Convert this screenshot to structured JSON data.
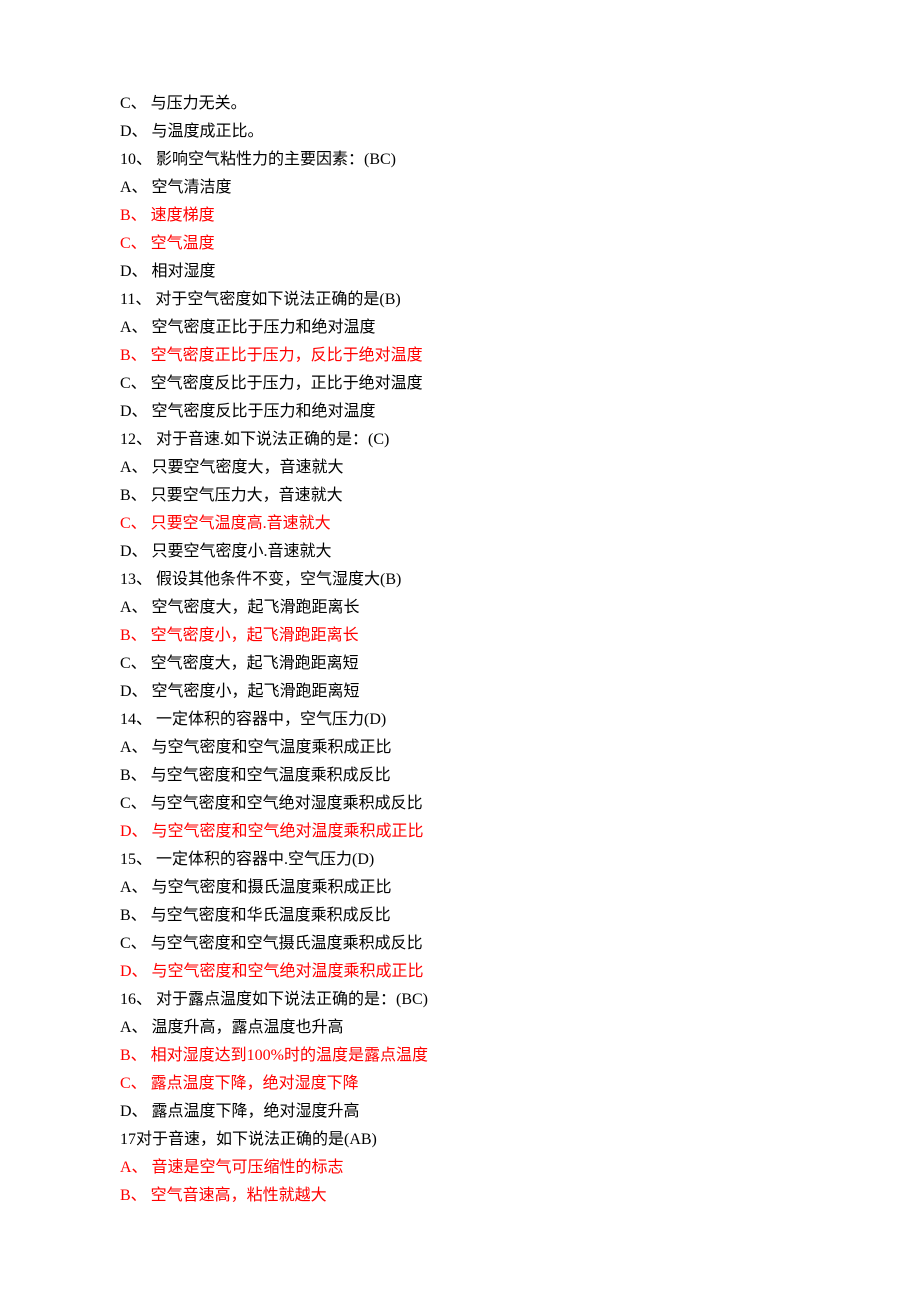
{
  "lines": [
    {
      "text": "C、 与压力无关。",
      "red": false
    },
    {
      "text": "D、 与温度成正比。",
      "red": false
    },
    {
      "text": "10、 影响空气粘性力的主要因素：(BC)",
      "red": false
    },
    {
      "text": "A、 空气清洁度",
      "red": false
    },
    {
      "text": "B、 速度梯度",
      "red": true
    },
    {
      "text": "C、 空气温度",
      "red": true
    },
    {
      "text": "D、 相对湿度",
      "red": false
    },
    {
      "text": "11、 对于空气密度如下说法正确的是(B)",
      "red": false
    },
    {
      "text": "A、 空气密度正比于压力和绝对温度",
      "red": false
    },
    {
      "text": "B、 空气密度正比于压力，反比于绝对温度",
      "red": true
    },
    {
      "text": "C、 空气密度反比于压力，正比于绝对温度",
      "red": false
    },
    {
      "text": "D、 空气密度反比于压力和绝对温度",
      "red": false
    },
    {
      "text": "12、 对于音速.如下说法正确的是：(C)",
      "red": false
    },
    {
      "text": "A、 只要空气密度大，音速就大",
      "red": false
    },
    {
      "text": "B、 只要空气压力大，音速就大",
      "red": false
    },
    {
      "text": "C、 只要空气温度高.音速就大",
      "red": true
    },
    {
      "text": "D、 只要空气密度小.音速就大",
      "red": false
    },
    {
      "text": "13、 假设其他条件不变，空气湿度大(B)",
      "red": false
    },
    {
      "text": "A、 空气密度大，起飞滑跑距离长",
      "red": false
    },
    {
      "text": "B、 空气密度小，起飞滑跑距离长",
      "red": true
    },
    {
      "text": "C、 空气密度大，起飞滑跑距离短",
      "red": false
    },
    {
      "text": "D、 空气密度小，起飞滑跑距离短",
      "red": false
    },
    {
      "text": "14、 一定体积的容器中，空气压力(D)",
      "red": false
    },
    {
      "text": "A、 与空气密度和空气温度乘积成正比",
      "red": false
    },
    {
      "text": "B、 与空气密度和空气温度乘积成反比",
      "red": false
    },
    {
      "text": "C、 与空气密度和空气绝对湿度乘积成反比",
      "red": false
    },
    {
      "text": "D、 与空气密度和空气绝对温度乘积成正比",
      "red": true
    },
    {
      "text": "15、 一定体积的容器中.空气压力(D)",
      "red": false
    },
    {
      "text": "A、 与空气密度和摄氏温度乘积成正比",
      "red": false
    },
    {
      "text": "B、 与空气密度和华氏温度乘积成反比",
      "red": false
    },
    {
      "text": "C、 与空气密度和空气摄氏温度乘积成反比",
      "red": false
    },
    {
      "text": "D、 与空气密度和空气绝对温度乘积成正比",
      "red": true
    },
    {
      "text": "16、 对于露点温度如下说法正确的是：(BC)",
      "red": false
    },
    {
      "text": "A、 温度升高，露点温度也升高",
      "red": false
    },
    {
      "text": "B、 相对湿度达到100%时的温度是露点温度",
      "red": true
    },
    {
      "text": "C、 露点温度下降，绝对湿度下降",
      "red": true
    },
    {
      "text": "D、 露点温度下降，绝对湿度升高",
      "red": false
    },
    {
      "text": "17对于音速，如下说法正确的是(AB)",
      "red": false
    },
    {
      "text": "A、 音速是空气可压缩性的标志",
      "red": true
    },
    {
      "text": "B、 空气音速高，粘性就越大",
      "red": true
    }
  ]
}
